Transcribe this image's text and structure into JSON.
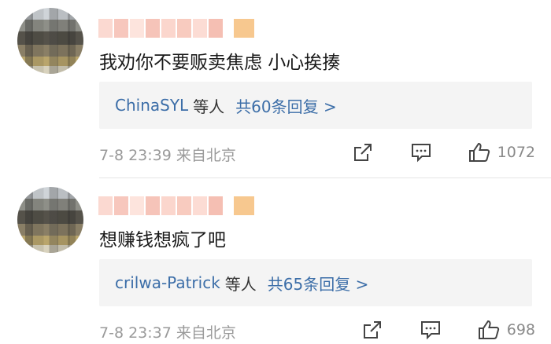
{
  "comments": [
    {
      "text": "我劝你不要贩卖焦虑 小心挨揍",
      "reply_user": "ChinaSYL",
      "reply_mid": "等人",
      "reply_count": "共60条回复 >",
      "meta": "7-8 23:39 来自北京",
      "likes": "1072"
    },
    {
      "text": "想赚钱想疯了吧",
      "reply_user": "crilwa-Patrick",
      "reply_mid": "等人",
      "reply_count": "共65条回复 >",
      "meta": "7-8 23:37 来自北京",
      "likes": "698"
    }
  ],
  "colors": {
    "link": "#3c6ea8",
    "meta": "#9a9a9a",
    "bubble": "#f4f4f4",
    "username_blur": "#f7c7bd"
  },
  "icons": [
    "share-icon",
    "comment-icon",
    "thumbs-up-icon"
  ]
}
